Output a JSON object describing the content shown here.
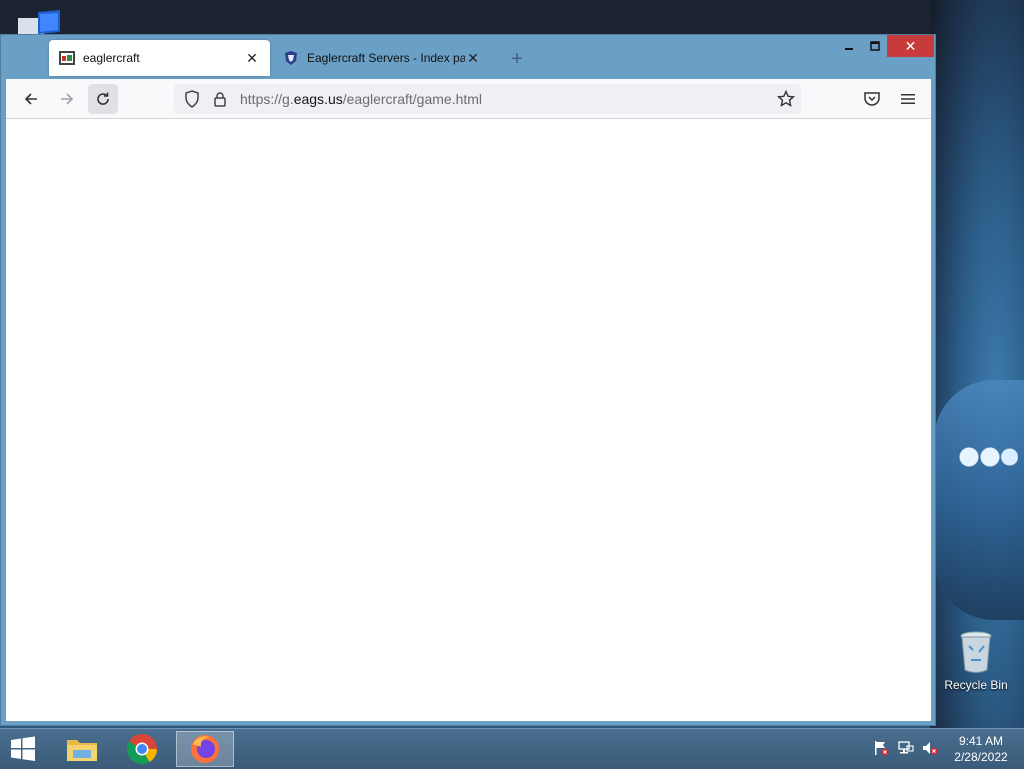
{
  "browser": {
    "tabs": [
      {
        "label": "eaglercraft",
        "active": true
      },
      {
        "label": "Eaglercraft Servers - Index page",
        "active": false
      }
    ],
    "new_tab_icon": "plus-icon",
    "url": {
      "prefix": "https://g.",
      "host": "eags.us",
      "path": "/eaglercraft/game.html"
    },
    "window_controls": [
      "minimize-icon",
      "maximize-icon",
      "close-icon"
    ]
  },
  "desktop": {
    "recycle_bin_label": "Recycle Bin"
  },
  "taskbar": {
    "apps": [
      "windows-start-icon",
      "file-explorer-icon",
      "chrome-icon",
      "firefox-icon"
    ],
    "tray_icons": [
      "action-center-flag-icon",
      "network-icon",
      "volume-muted-icon"
    ],
    "time": "9:41 AM",
    "date": "2/28/2022"
  },
  "colors": {
    "window_frame": "#6a9fc6",
    "close_button": "#c73b3b",
    "taskbar": "#3a5b79"
  }
}
